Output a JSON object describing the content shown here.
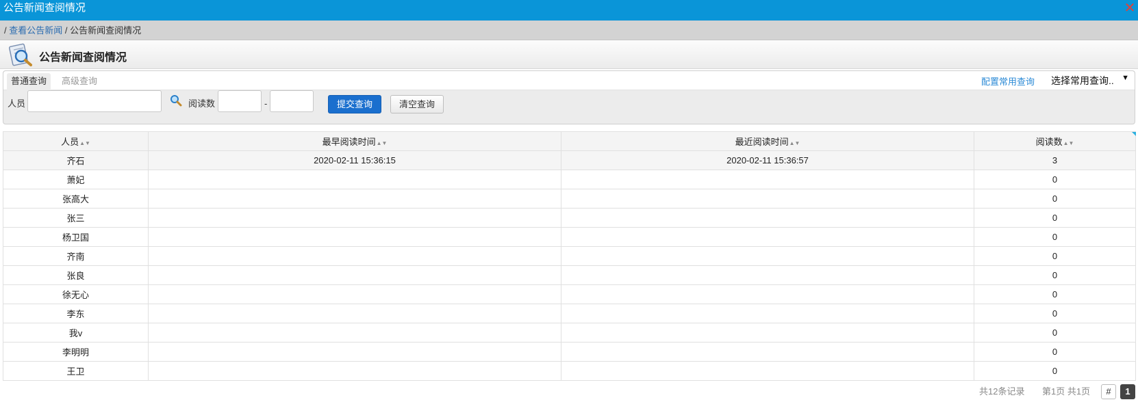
{
  "window": {
    "title": "公告新闻查阅情况",
    "close_symbol": "✕"
  },
  "breadcrumb": {
    "sep1": "/ ",
    "link": "查看公告新闻",
    "sep2": " / ",
    "current": "公告新闻查阅情况"
  },
  "page": {
    "title": "公告新闻查阅情况",
    "icon": "document-search-icon"
  },
  "search": {
    "tab_basic": "普通查询",
    "tab_advanced": "高级查询",
    "config_link": "配置常用查询",
    "common_select": "选择常用查询..",
    "person_label": "人员",
    "person_value": "",
    "reads_label": "阅读数",
    "reads_from": "",
    "reads_sep": "-",
    "reads_to": "",
    "submit_label": "提交查询",
    "clear_label": "清空查询"
  },
  "table": {
    "columns": [
      "人员",
      "最早阅读时间",
      "最近阅读时间",
      "阅读数"
    ],
    "rows": [
      [
        "齐石",
        "2020-02-11 15:36:15",
        "2020-02-11 15:36:57",
        "3"
      ],
      [
        "萧妃",
        "",
        "",
        "0"
      ],
      [
        "张高大",
        "",
        "",
        "0"
      ],
      [
        "张三",
        "",
        "",
        "0"
      ],
      [
        "杨卫国",
        "",
        "",
        "0"
      ],
      [
        "齐南",
        "",
        "",
        "0"
      ],
      [
        "张良",
        "",
        "",
        "0"
      ],
      [
        "徐无心",
        "",
        "",
        "0"
      ],
      [
        "李东",
        "",
        "",
        "0"
      ],
      [
        "我v",
        "",
        "",
        "0"
      ],
      [
        "李明明",
        "",
        "",
        "0"
      ],
      [
        "王卫",
        "",
        "",
        "0"
      ]
    ]
  },
  "pager": {
    "total": "共12条记录",
    "pages": "第1页 共1页",
    "hash": "#",
    "current": "1"
  },
  "colors": {
    "titlebar": "#0a95d8",
    "primary_button": "#1a6fce",
    "close": "#e0413a"
  }
}
